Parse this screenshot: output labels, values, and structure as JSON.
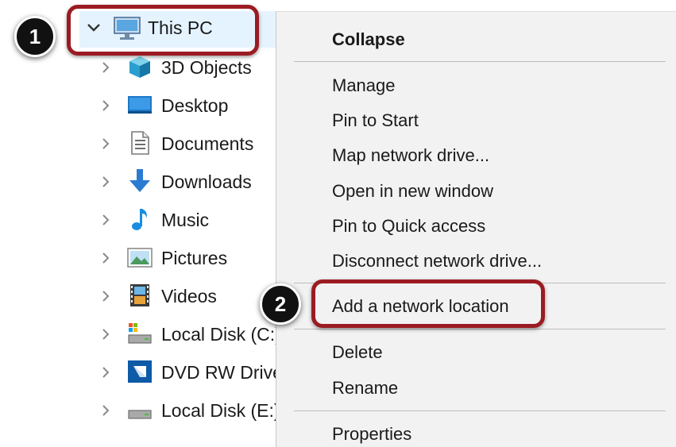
{
  "tree": {
    "root": {
      "label": "This PC",
      "icon": "computer-icon",
      "expanded": true
    },
    "items": [
      {
        "label": "3D Objects",
        "icon": "3d-objects-icon"
      },
      {
        "label": "Desktop",
        "icon": "desktop-icon"
      },
      {
        "label": "Documents",
        "icon": "documents-icon"
      },
      {
        "label": "Downloads",
        "icon": "download-arrow-icon"
      },
      {
        "label": "Music",
        "icon": "music-note-icon"
      },
      {
        "label": "Pictures",
        "icon": "pictures-icon"
      },
      {
        "label": "Videos",
        "icon": "videos-icon"
      },
      {
        "label": "Local Disk (C:)",
        "icon": "system-drive-icon"
      },
      {
        "label": "DVD RW Drive",
        "icon": "dvd-drive-icon"
      },
      {
        "label": "Local Disk (E:)",
        "icon": "hard-drive-icon"
      }
    ]
  },
  "context_menu": {
    "collapse": "Collapse",
    "manage": "Manage",
    "pin_to_start": "Pin to Start",
    "map_network_drive": "Map network drive...",
    "open_in_new_window": "Open in new window",
    "pin_to_quick_access": "Pin to Quick access",
    "disconnect_network_drive": "Disconnect network drive...",
    "add_network_location": "Add a network location",
    "delete": "Delete",
    "rename": "Rename",
    "properties": "Properties"
  },
  "annotations": {
    "step1": "1",
    "step2": "2",
    "highlight_color": "#9b1b22",
    "badge_color": "#111111"
  },
  "colors": {
    "selection": "#e5f3ff",
    "menu_background": "#f2f2f2",
    "separator": "#bdbdbd"
  }
}
